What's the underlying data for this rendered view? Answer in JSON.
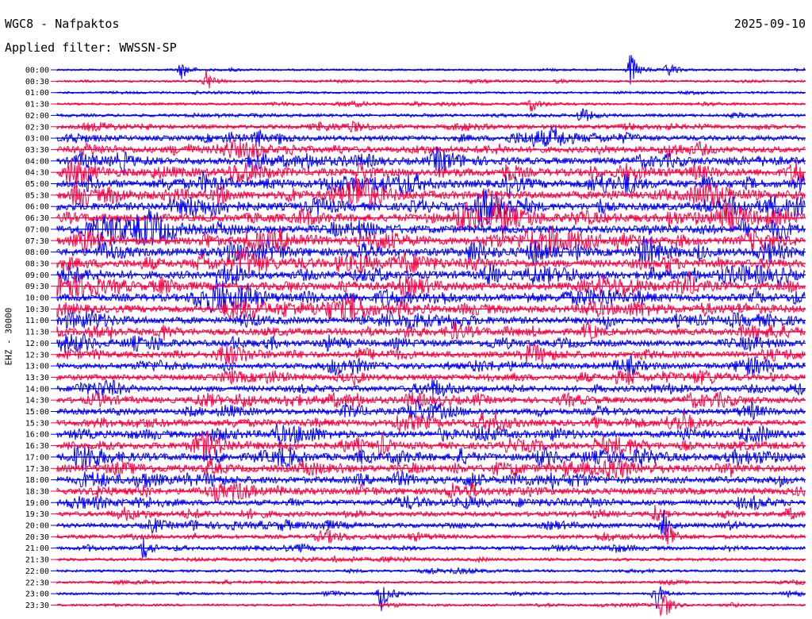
{
  "header": {
    "station": "WGC8 - Nafpaktos",
    "date": "2025-09-10",
    "filter": "Applied filter: WWSSN-SP"
  },
  "channel_label": "EHZ - 30000",
  "colors": {
    "trace_a": "#0000ff",
    "trace_b": "#ff0040",
    "background": "#ffffff",
    "text": "#000000"
  },
  "chart_data": {
    "type": "line",
    "title": "WGC8 - Nafpaktos",
    "subtitle": "Applied filter: WWSSN-SP",
    "ylabel": "EHZ - 30000",
    "xlabel": "",
    "row_labels": [
      "00:00",
      "00:30",
      "01:00",
      "01:30",
      "02:00",
      "02:30",
      "03:00",
      "03:30",
      "04:00",
      "04:30",
      "05:00",
      "05:30",
      "06:00",
      "06:30",
      "07:00",
      "07:30",
      "08:00",
      "08:30",
      "09:00",
      "09:30",
      "10:00",
      "10:30",
      "11:00",
      "11:30",
      "12:00",
      "12:30",
      "13:00",
      "13:30",
      "14:00",
      "14:30",
      "15:00",
      "15:30",
      "16:00",
      "16:30",
      "17:00",
      "17:30",
      "18:00",
      "18:30",
      "19:00",
      "19:30",
      "20:00",
      "20:30",
      "21:00",
      "21:30",
      "22:00",
      "22:30",
      "23:00",
      "23:30"
    ],
    "series": [
      {
        "color": "#0000ff",
        "rows": "even"
      },
      {
        "color": "#ff0040",
        "rows": "odd"
      }
    ],
    "row_activity": [
      0.15,
      0.18,
      0.18,
      0.22,
      0.3,
      0.45,
      0.6,
      0.75,
      0.85,
      0.95,
      1.0,
      1.0,
      1.0,
      1.0,
      1.0,
      1.0,
      1.0,
      1.0,
      1.0,
      1.0,
      0.95,
      0.9,
      0.85,
      0.8,
      0.78,
      0.75,
      0.72,
      0.7,
      0.7,
      0.7,
      0.7,
      0.75,
      0.8,
      0.85,
      0.9,
      0.9,
      0.85,
      0.8,
      0.65,
      0.55,
      0.5,
      0.45,
      0.4,
      0.3,
      0.22,
      0.2,
      0.2,
      0.2
    ],
    "events": [
      {
        "row": 0,
        "x_min": 23,
        "amp": 2.4
      },
      {
        "row": 0,
        "x_min": 5,
        "amp": 1.1
      },
      {
        "row": 0,
        "x_min": 24.5,
        "amp": 1.0
      },
      {
        "row": 1,
        "x_min": 6,
        "amp": 1.6
      },
      {
        "row": 3,
        "x_min": 19,
        "amp": 1.0
      },
      {
        "row": 4,
        "x_min": 21,
        "amp": 1.3
      },
      {
        "row": 6,
        "x_min": 8,
        "amp": 1.5
      },
      {
        "row": 33,
        "x_min": 13,
        "amp": 1.6
      },
      {
        "row": 39,
        "x_min": 24,
        "amp": 1.4
      },
      {
        "row": 40,
        "x_min": 24.3,
        "amp": 2.0
      },
      {
        "row": 41,
        "x_min": 24.5,
        "amp": 2.8
      },
      {
        "row": 42,
        "x_min": 3.5,
        "amp": 1.8
      },
      {
        "row": 46,
        "x_min": 13,
        "amp": 2.5
      },
      {
        "row": 46,
        "x_min": 24,
        "amp": 2.2
      },
      {
        "row": 47,
        "x_min": 24.3,
        "amp": 2.6
      }
    ]
  }
}
